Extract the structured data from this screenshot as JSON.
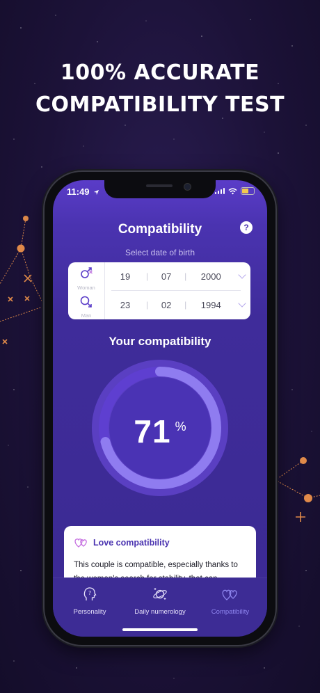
{
  "promo": {
    "headline_line1": "100% ACCURATE",
    "headline_line2": "COMPATIBILITY TEST"
  },
  "status_bar": {
    "time": "11:49"
  },
  "app": {
    "title": "Compatibility",
    "help_label": "?",
    "subtitle": "Select date of birth"
  },
  "dob": {
    "woman": {
      "label": "Woman",
      "day": "19",
      "month": "07",
      "year": "2000"
    },
    "man": {
      "label": "Man",
      "day": "23",
      "month": "02",
      "year": "1994"
    },
    "separator": "|"
  },
  "result": {
    "heading": "Your compatibility",
    "value": "71",
    "unit": "%",
    "percent": 71
  },
  "love_card": {
    "title": "Love compatibility",
    "body": "This couple is compatible, especially thanks to the woman's search for stability, that can"
  },
  "tabs": [
    {
      "label": "Personality",
      "icon": "head-question-icon",
      "active": false
    },
    {
      "label": "Daily numerology",
      "icon": "planet-icon",
      "active": false
    },
    {
      "label": "Compatibility",
      "icon": "hearts-icon",
      "active": true
    }
  ],
  "colors": {
    "accent": "#5a3cc8",
    "gauge_track": "#6a4fd4",
    "gauge_fill": "#8f7cf0",
    "constellation": "#e08a4a"
  }
}
